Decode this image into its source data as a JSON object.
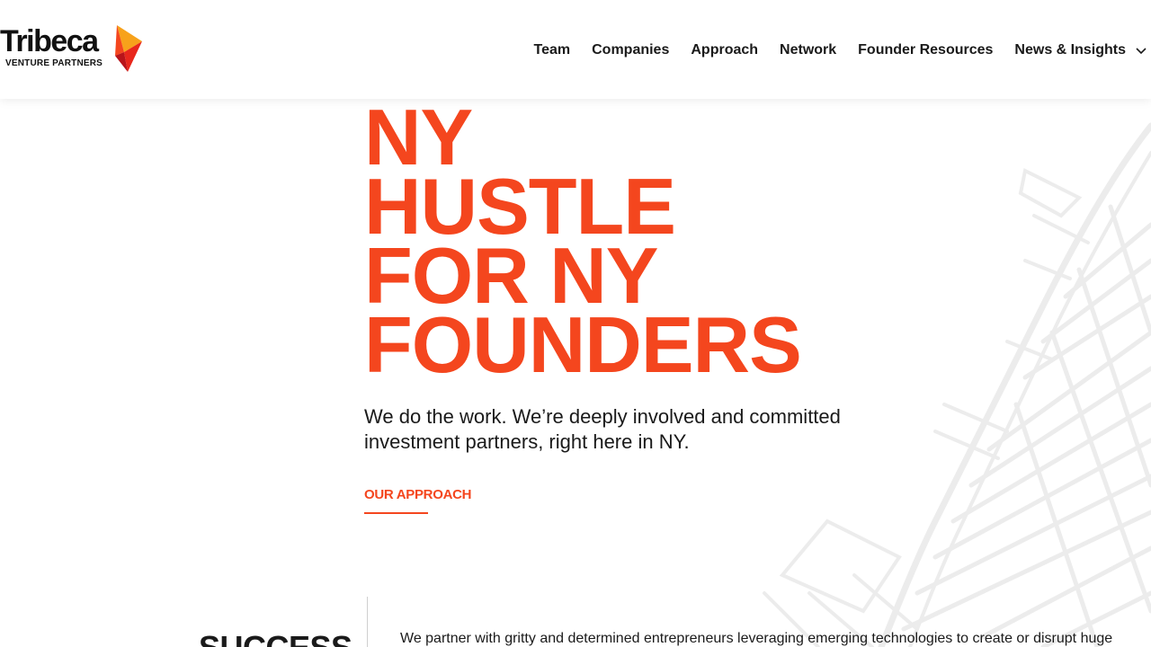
{
  "header": {
    "logo": {
      "word": "Tribeca",
      "sub": "VENTURE PARTNERS"
    },
    "nav": [
      {
        "label": "Team"
      },
      {
        "label": "Companies"
      },
      {
        "label": "Approach"
      },
      {
        "label": "Network"
      },
      {
        "label": "Founder Resources"
      },
      {
        "label": "News & Insights",
        "icon": "chevron-down-icon"
      }
    ]
  },
  "hero": {
    "title_lines": [
      "NY",
      "HUSTLE",
      "FOR NY",
      "FOUNDERS"
    ],
    "subtitle": "We do the work. We’re deeply involved and committed investment partners, right here in NY.",
    "cta": "OUR APPROACH"
  },
  "success": {
    "title": "SUCCESS",
    "text": "We partner with gritty and determined entrepreneurs leveraging emerging technologies to create or disrupt huge"
  },
  "colors": {
    "accent": "#f4461e",
    "text": "#1a1a1a",
    "map_lines": "#ececec"
  },
  "icons": {
    "logo_mark": "tribeca-arrow-logo",
    "nav_more": "chevron-down-icon",
    "background": "street-map-illustration"
  }
}
